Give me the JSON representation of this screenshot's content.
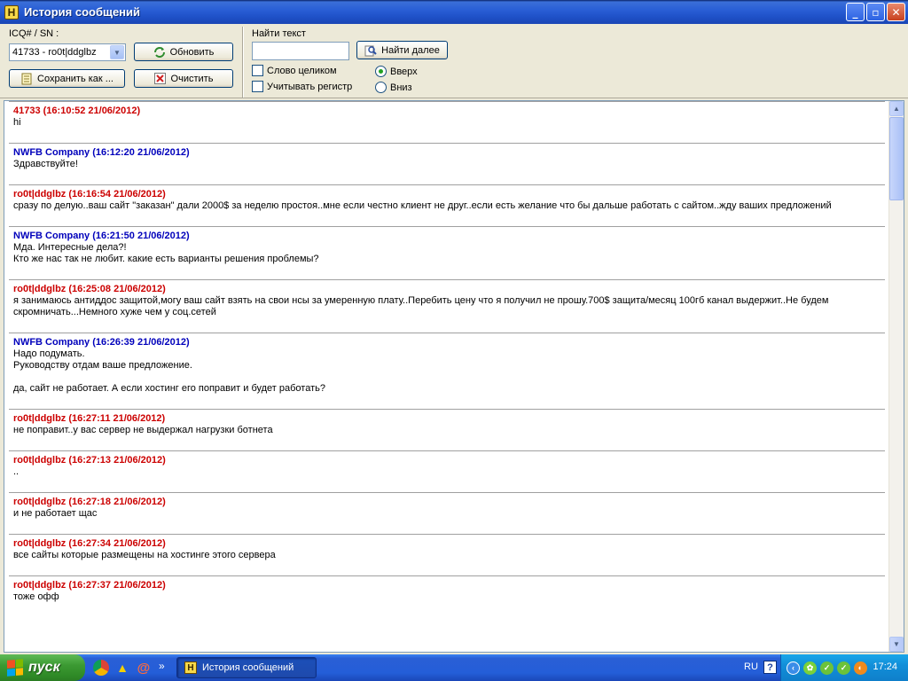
{
  "window": {
    "title": "История сообщений",
    "app_icon_letter": "H",
    "controls": {
      "minimize": "_",
      "maximize": "▫",
      "close": "✕"
    }
  },
  "toolbar": {
    "icq_label": "ICQ# / SN :",
    "contact_value": "41733 - ro0t|ddglbz",
    "refresh_label": "Обновить",
    "save_label": "Сохранить как ...",
    "clear_label": "Очистить",
    "search_label": "Найти текст",
    "search_value": "",
    "find_next_label": "Найти далее",
    "whole_word_label": "Слово целиком",
    "whole_word_checked": false,
    "match_case_label": "Учитывать регистр",
    "match_case_checked": false,
    "direction_up_label": "Вверх",
    "direction_down_label": "Вниз",
    "direction_selected": "up"
  },
  "messages": [
    {
      "sender": "41733",
      "time": "16:10:52 21/06/2012",
      "self": true,
      "lines": [
        "hi"
      ]
    },
    {
      "sender": "NWFB Company",
      "time": "16:12:20 21/06/2012",
      "self": false,
      "lines": [
        "Здравствуйте!"
      ]
    },
    {
      "sender": "ro0t|ddglbz",
      "time": "16:16:54 21/06/2012",
      "self": true,
      "lines": [
        "сразу по делую..ваш сайт \"заказан\" дали 2000$ за неделю простоя..мне если честно клиент не друг..если есть желание что бы дальше работать с сайтом..жду ваших предложений"
      ]
    },
    {
      "sender": "NWFB Company",
      "time": "16:21:50 21/06/2012",
      "self": false,
      "lines": [
        "Мда. Интересные дела?!",
        "Кто же нас так не любит. какие есть варианты решения проблемы?"
      ]
    },
    {
      "sender": "ro0t|ddglbz",
      "time": "16:25:08 21/06/2012",
      "self": true,
      "lines": [
        "я занимаюсь антиддос защитой,могу ваш сайт взять на свои нсы за умеренную плату..Перебить цену что я получил не прошу.700$ защита/месяц 100гб канал выдержит..Не будем",
        "скромничать...Немного хуже чем у соц.сетей"
      ]
    },
    {
      "sender": "NWFB Company",
      "time": "16:26:39 21/06/2012",
      "self": false,
      "lines": [
        "Надо подумать.",
        "Руководству отдам ваше предложение.",
        "",
        "да, сайт не работает. А если хостинг его поправит и будет работать?"
      ]
    },
    {
      "sender": "ro0t|ddglbz",
      "time": "16:27:11 21/06/2012",
      "self": true,
      "lines": [
        "не поправит..у вас сервер не выдержал нагрузки ботнета"
      ]
    },
    {
      "sender": "ro0t|ddglbz",
      "time": "16:27:13 21/06/2012",
      "self": true,
      "lines": [
        ".."
      ]
    },
    {
      "sender": "ro0t|ddglbz",
      "time": "16:27:18 21/06/2012",
      "self": true,
      "lines": [
        "и не работает щас"
      ]
    },
    {
      "sender": "ro0t|ddglbz",
      "time": "16:27:34 21/06/2012",
      "self": true,
      "lines": [
        "все сайты которые размещены на хостинге этого сервера"
      ]
    },
    {
      "sender": "ro0t|ddglbz",
      "time": "16:27:37 21/06/2012",
      "self": true,
      "lines": [
        "тоже офф"
      ]
    }
  ],
  "colors": {
    "self_sender": "#cc0000",
    "other_sender": "#0000bb"
  },
  "taskbar": {
    "start_label": "пуск",
    "task_label": "История сообщений",
    "language": "RU",
    "help": "?",
    "clock": "17:24",
    "quick_launch_icons": [
      "chrome-icon",
      "tortoise-icon",
      "mail-at-icon"
    ],
    "chevron": "»",
    "tray_icons": [
      "back-arrow-icon",
      "icq-flower-icon",
      "check-green-icon",
      "check-green-icon",
      "antivirus-icon"
    ]
  }
}
